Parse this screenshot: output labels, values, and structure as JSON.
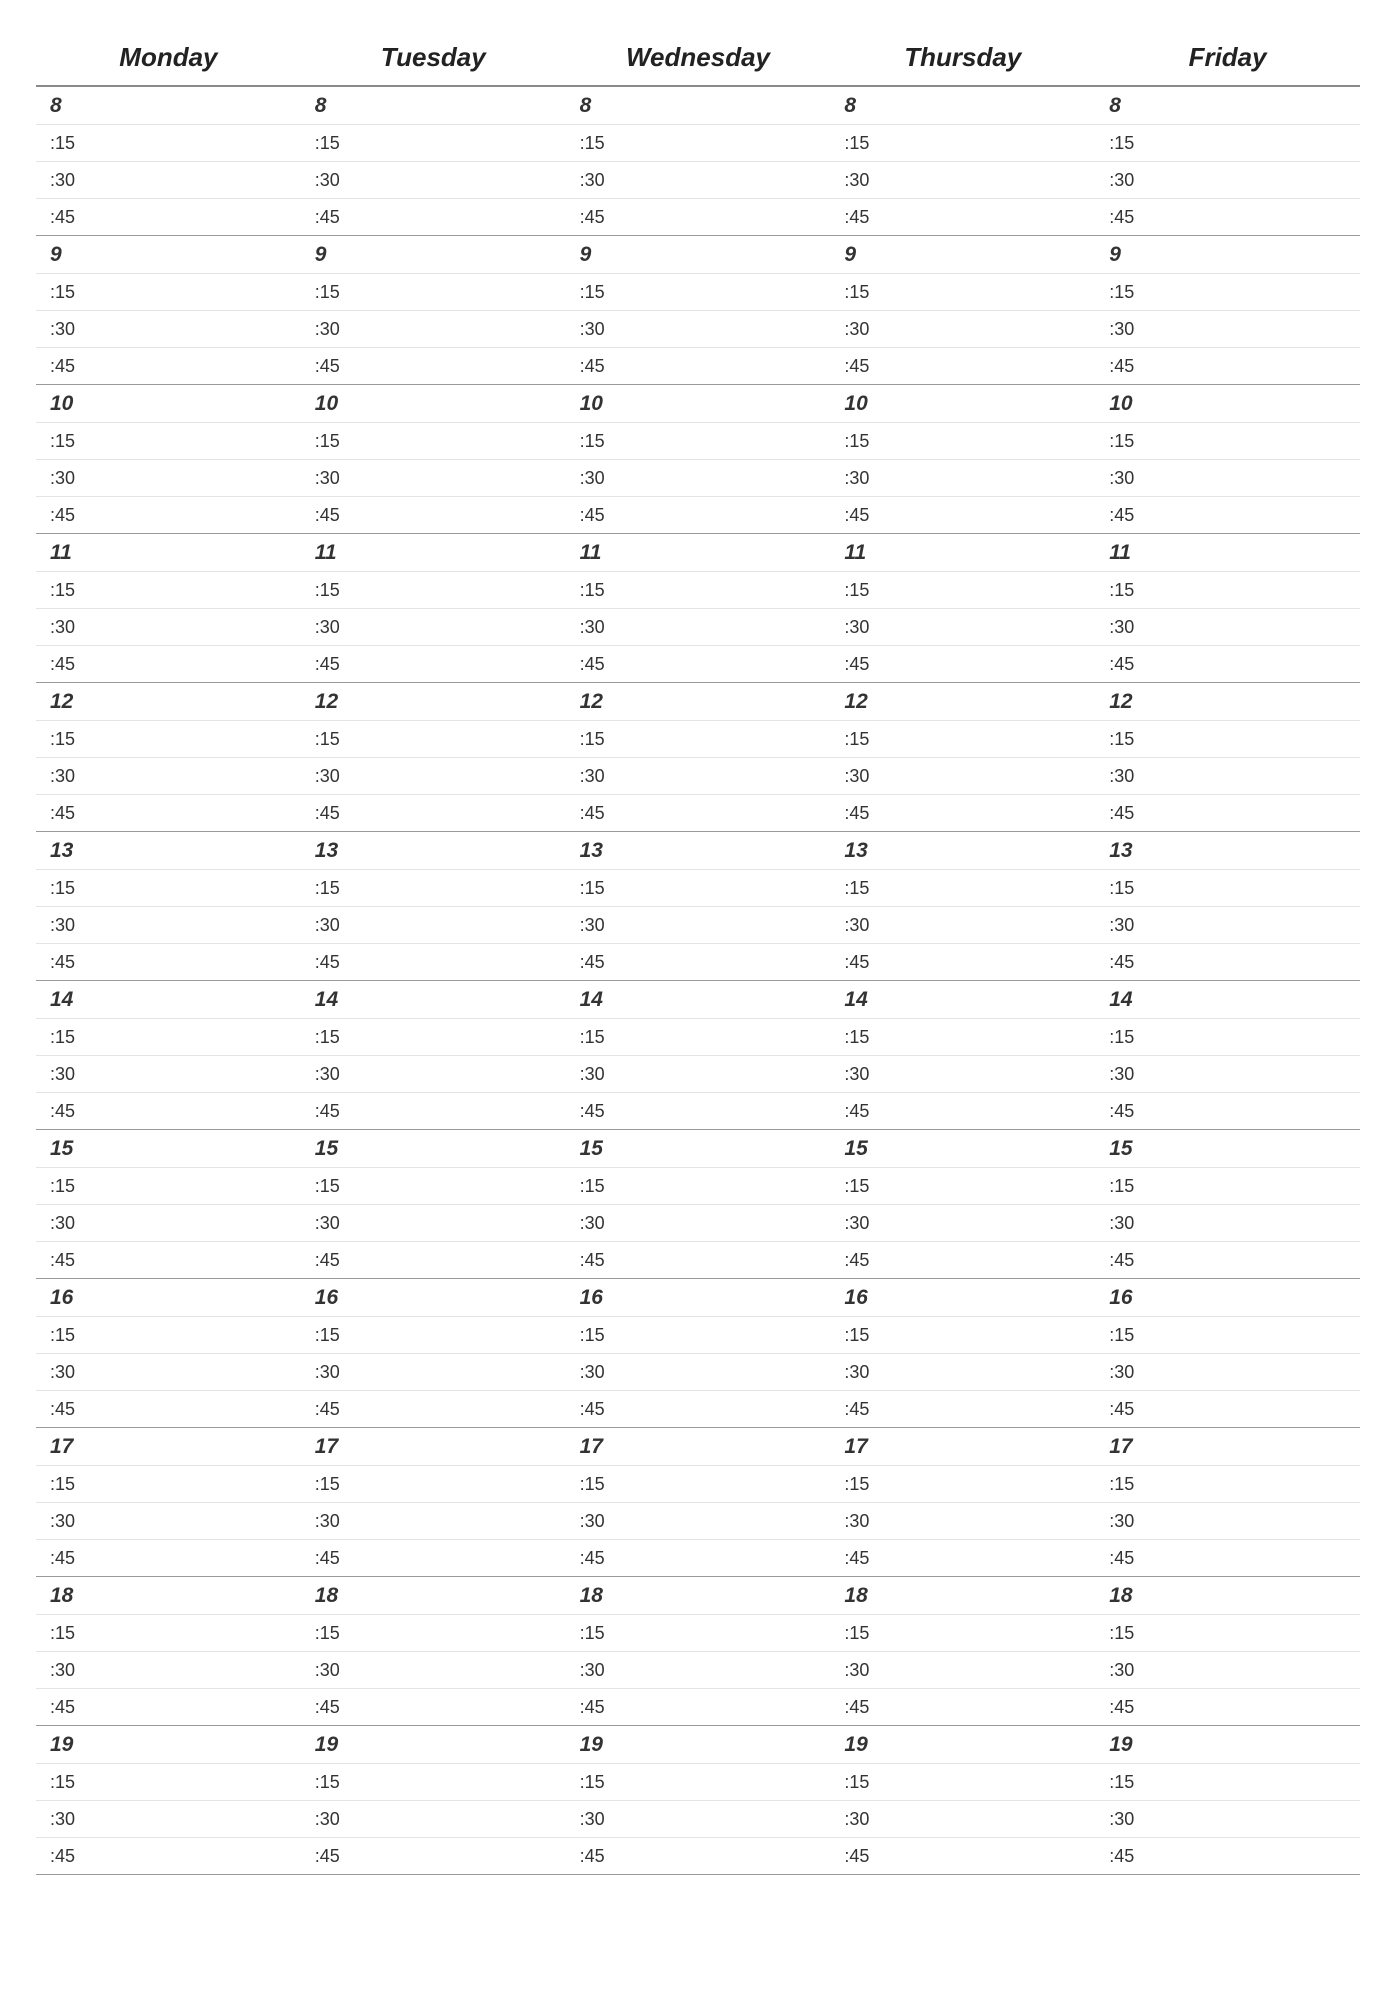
{
  "schedule": {
    "days": [
      "Monday",
      "Tuesday",
      "Wednesday",
      "Thursday",
      "Friday"
    ],
    "hours": [
      8,
      9,
      10,
      11,
      12,
      13,
      14,
      15,
      16,
      17,
      18,
      19
    ],
    "minute_labels": [
      ":15",
      ":30",
      ":45"
    ]
  }
}
